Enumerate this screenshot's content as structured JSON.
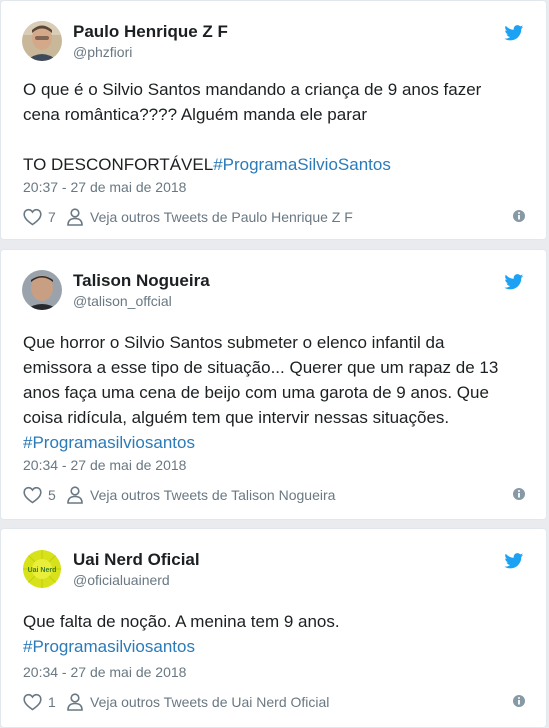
{
  "tweets": [
    {
      "name": "Paulo Henrique Z F",
      "handle": "@phzfiori",
      "text_lines": [
        "O que é o Silvio Santos mandando a criança de 9 anos fazer",
        "cena romântica???? Alguém manda ele parar"
      ],
      "text_after": "TO DESCONFORTÁVEL",
      "hashtag": "#ProgramaSilvioSantos",
      "date": "20:37 - 27 de mai de 2018",
      "likes": "7",
      "see_more": "Veja outros Tweets de Paulo Henrique Z F"
    },
    {
      "name": "Talison Nogueira",
      "handle": "@talison_offcial",
      "text_lines": [
        "Que horror o Silvio Santos submeter o elenco infantil da",
        "emissora a esse tipo de situação... Querer que um rapaz de 13",
        "anos faça uma cena de beijo com uma garota de 9 anos. Que",
        "coisa ridícula, alguém tem que intervir nessas situações."
      ],
      "hashtag": "#Programasilviosantos",
      "date": "20:34 - 27 de mai de 2018",
      "likes": "5",
      "see_more": "Veja outros Tweets de Talison Nogueira"
    },
    {
      "name": "Uai Nerd Oficial",
      "handle": "@oficialuainerd",
      "avatar_text": "Uai Nerd",
      "text_lines": [
        "Que falta de noção. A menina tem 9 anos."
      ],
      "hashtag": "#Programasilviosantos",
      "date": "20:34 - 27 de mai de 2018",
      "likes": "1",
      "see_more": "Veja outros Tweets de Uai Nerd Oficial"
    }
  ],
  "colors": {
    "link": "#2b7bb9",
    "meta_gray": "#697882",
    "twitter_blue": "#1da1f2",
    "text": "#1c2022",
    "background": "#e9ebee"
  },
  "icons": {
    "bird": "twitter-bird-icon",
    "like": "heart-icon",
    "profile": "person-icon",
    "info": "info-icon"
  }
}
